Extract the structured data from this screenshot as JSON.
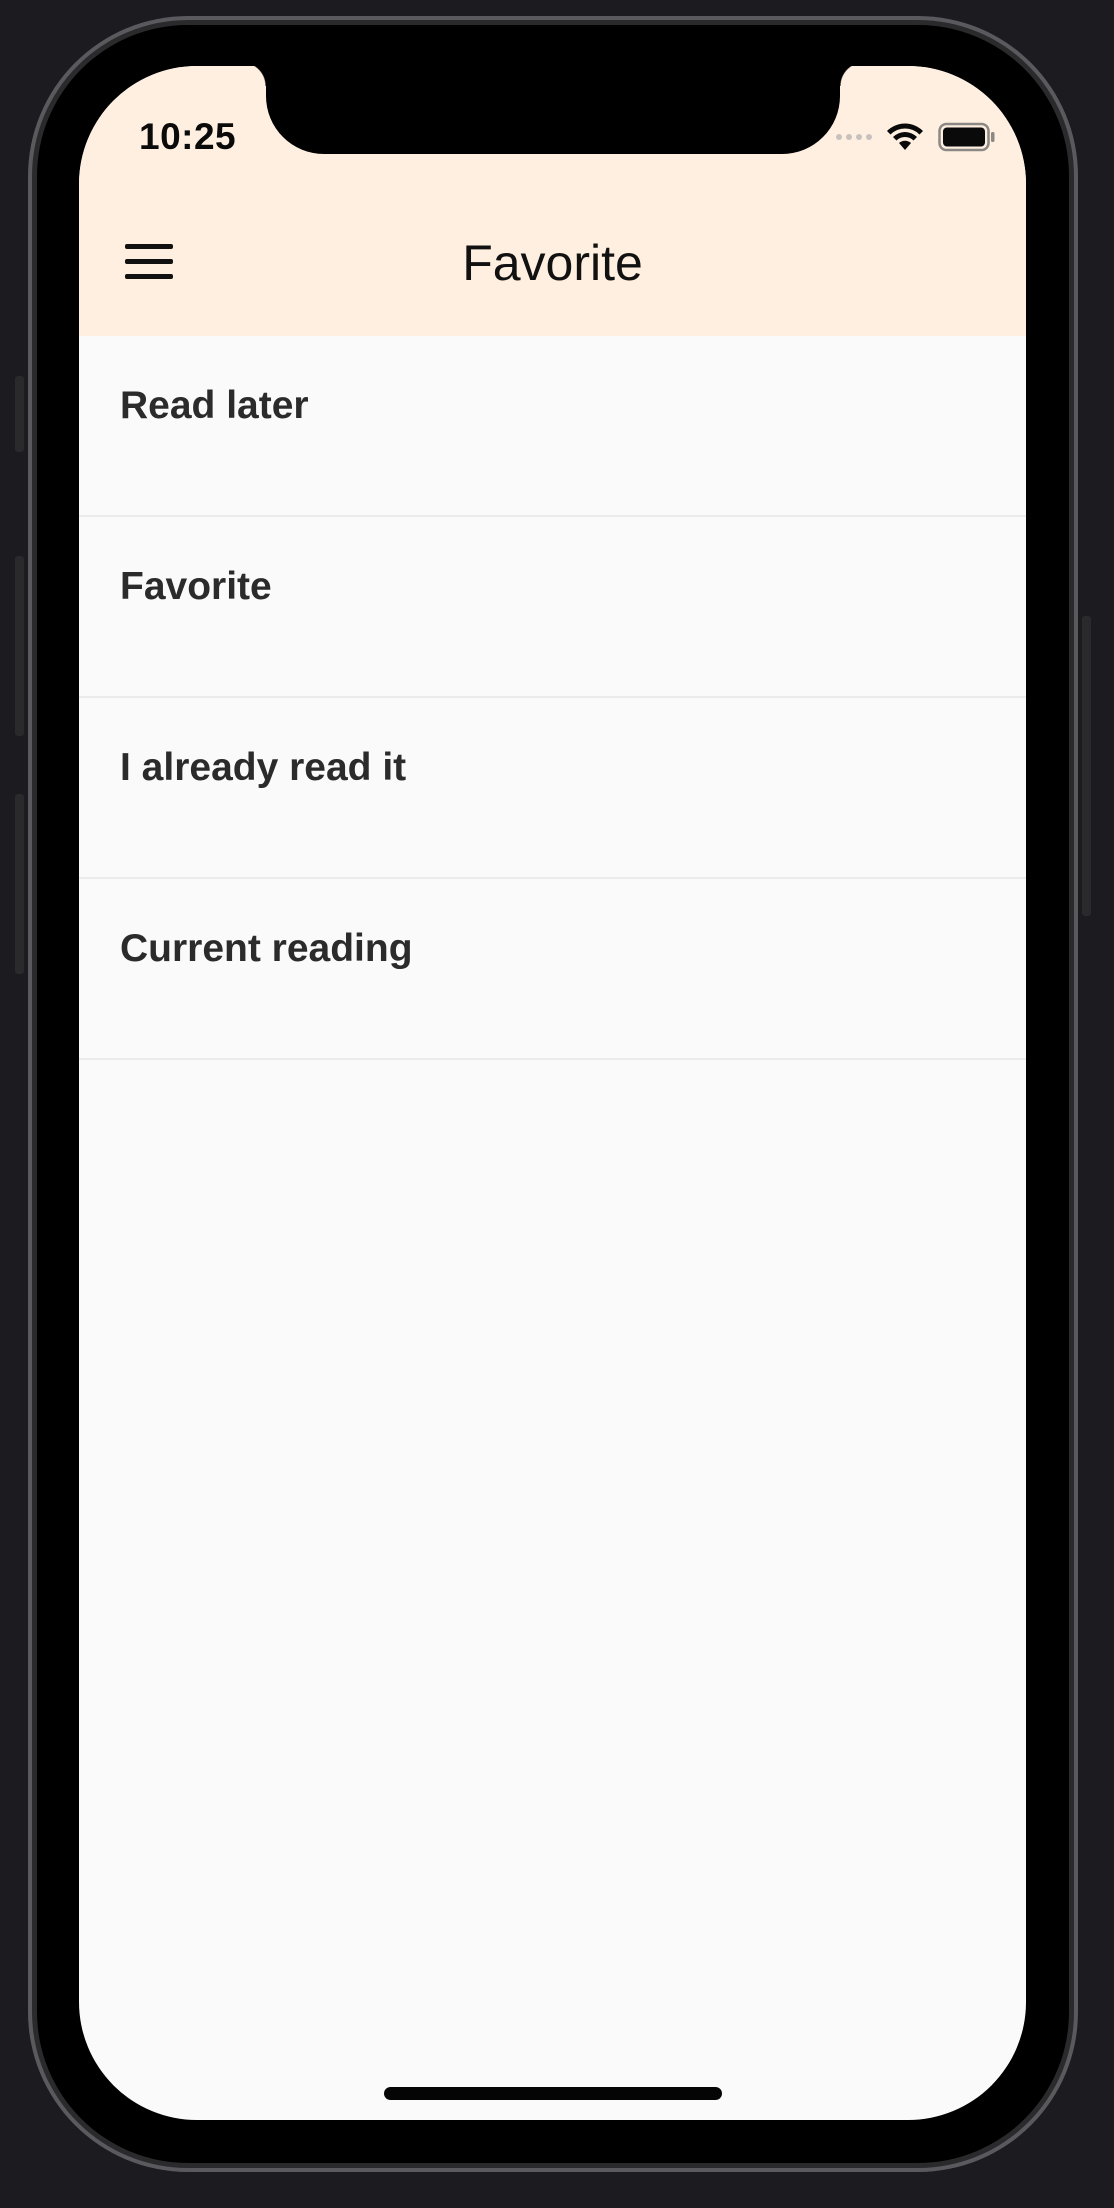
{
  "status_bar": {
    "time": "10:25"
  },
  "header": {
    "title": "Favorite",
    "menu_icon": "hamburger-menu-icon"
  },
  "list": {
    "items": [
      {
        "label": "Read later"
      },
      {
        "label": "Favorite"
      },
      {
        "label": "I already read it"
      },
      {
        "label": "Current reading"
      }
    ]
  },
  "colors": {
    "header_background": "#ffefe1",
    "page_background": "#fafafa",
    "item_text": "#2b2b2b",
    "divider": "#ebebeb"
  }
}
